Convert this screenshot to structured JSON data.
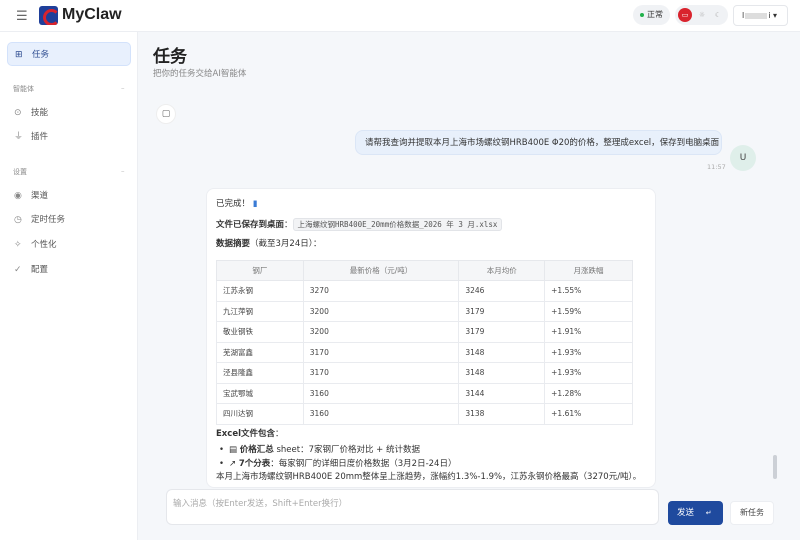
{
  "header": {
    "brand": "MyClaw",
    "status": "正常",
    "user": "l",
    "user_suffix": "i",
    "accent": "#1f4a9e",
    "status_color": "#22b14c",
    "active_mode_color": "#d9232d"
  },
  "sidebar": {
    "items": [
      {
        "label": "任务",
        "icon": "task-icon"
      }
    ],
    "section_agents": "智能体",
    "agents": [
      {
        "label": "技能",
        "icon": "skill-icon"
      },
      {
        "label": "插件",
        "icon": "plug-icon"
      }
    ],
    "section_settings": "设置",
    "settings": [
      {
        "label": "渠道",
        "icon": "signal-icon"
      },
      {
        "label": "定时任务",
        "icon": "clock-icon"
      },
      {
        "label": "个性化",
        "icon": "sparkle-icon"
      },
      {
        "label": "配置",
        "icon": "check-icon"
      }
    ]
  },
  "main": {
    "title": "任务",
    "subtitle": "把你的任务交给AI智能体"
  },
  "chat": {
    "user_message": "请帮我查询并提取本月上海市场螺纹钢HRB400E Φ20的价格，整理成excel，保存到电脑桌面",
    "user_avatar": "U",
    "user_time": "11:57",
    "reply": {
      "done": "已完成！",
      "saved_label": "文件已保存到桌面",
      "saved_colon": "：",
      "file": "上海螺纹钢HRB400E_20mm价格数据_2026 年 3 月.xlsx",
      "summary_label": "数据摘要",
      "summary_note": "（截至3月24日）：",
      "table": {
        "headers": [
          "钢厂",
          "最新价格（元/吨）",
          "本月均价",
          "月涨跌幅"
        ],
        "rows": [
          [
            "江苏永钢",
            "3270",
            "3246",
            "+1.55%"
          ],
          [
            "九江萍钢",
            "3200",
            "3179",
            "+1.59%"
          ],
          [
            "敬业钢铁",
            "3200",
            "3179",
            "+1.91%"
          ],
          [
            "芜湖富鑫",
            "3170",
            "3148",
            "+1.93%"
          ],
          [
            "泾县隆鑫",
            "3170",
            "3148",
            "+1.93%"
          ],
          [
            "宝武鄂城",
            "3160",
            "3144",
            "+1.28%"
          ],
          [
            "四川达钢",
            "3160",
            "3138",
            "+1.61%"
          ]
        ]
      },
      "excel_label": "Excel文件包含",
      "excel_colon": "：",
      "bullets": [
        {
          "bold": "价格汇总",
          "text": " sheet：7家钢厂价格对比 + 统计数据"
        },
        {
          "bold": "7个分表",
          "text": "：每家钢厂的详细日度价格数据（3月2日-24日）"
        }
      ],
      "conclusion": "本月上海市场螺纹钢HRB400E 20mm整体呈上涨趋势，涨幅约1.3%-1.9%，江苏永钢价格最高（3270元/吨）。"
    }
  },
  "composer": {
    "placeholder": "输入消息（按Enter发送，Shift+Enter换行）",
    "send": "发送",
    "new_task": "新任务"
  }
}
